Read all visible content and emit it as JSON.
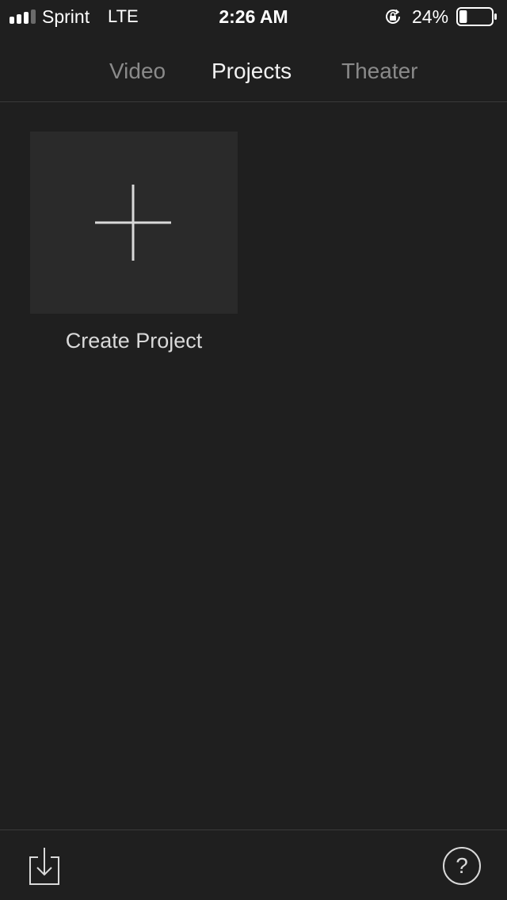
{
  "status_bar": {
    "carrier": "Sprint",
    "network": "LTE",
    "time": "2:26 AM",
    "battery_percent": "24%",
    "battery_level": 0.24,
    "signal_bars": 4,
    "icons": [
      "signal-icon",
      "orientation-lock-icon",
      "battery-icon"
    ]
  },
  "tabs": {
    "items": [
      {
        "label": "Video",
        "active": false
      },
      {
        "label": "Projects",
        "active": true
      },
      {
        "label": "Theater",
        "active": false
      }
    ]
  },
  "main": {
    "create_project_label": "Create Project",
    "create_icon": "plus-icon"
  },
  "toolbar": {
    "import_icon": "import-icon",
    "help_label": "?"
  },
  "colors": {
    "background": "#1f1f1f",
    "tile": "#2a2a2a",
    "active_text": "#f2f2f2",
    "inactive_text": "#8a8a8a",
    "divider": "#3a3a3a"
  }
}
